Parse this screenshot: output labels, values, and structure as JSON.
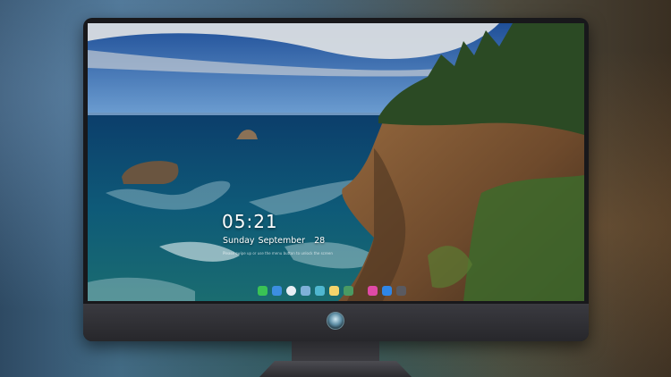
{
  "lockscreen": {
    "time": "05:21",
    "day": "Sunday",
    "month": "September",
    "date": "28",
    "note": "Please swipe up or use the menu button to unlock the screen"
  },
  "dock": {
    "apps": [
      {
        "name": "messages-icon",
        "glyph": "",
        "color": "#3ac255"
      },
      {
        "name": "finder-icon",
        "glyph": "",
        "color": "#3c8ee0"
      },
      {
        "name": "safari-icon",
        "glyph": "",
        "color": "#e8eef4"
      },
      {
        "name": "mail-icon",
        "glyph": "",
        "color": "#7fb0d8"
      },
      {
        "name": "photos-icon",
        "glyph": "",
        "color": "#4fb7d0"
      },
      {
        "name": "notes-icon",
        "glyph": "",
        "color": "#f3d36b"
      },
      {
        "name": "preview-icon",
        "glyph": "",
        "color": "#4a9a63"
      },
      {
        "name": "music-icon",
        "glyph": "",
        "color": "#e04aa6"
      },
      {
        "name": "app-store-icon",
        "glyph": "",
        "color": "#2f86e6"
      },
      {
        "name": "camera-icon",
        "glyph": "",
        "color": "#5a5a60"
      }
    ]
  },
  "colors": {
    "sky": "#2e72c0",
    "sea": "#0f5a78",
    "cliff": "#7a5434",
    "forest": "#2f5228"
  }
}
